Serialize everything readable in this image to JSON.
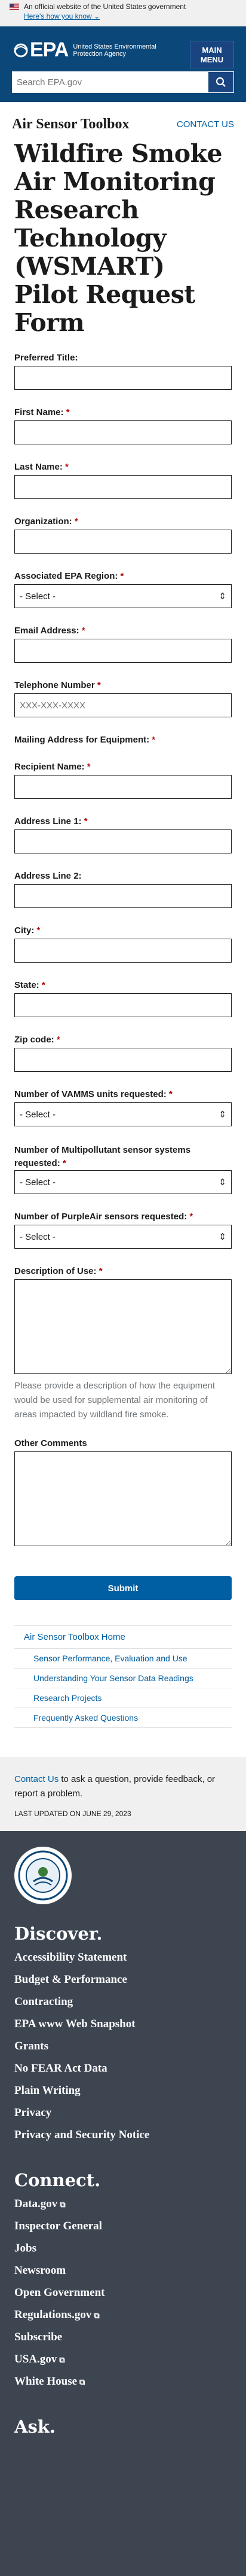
{
  "gov_banner": {
    "text": "An official website of the United States government",
    "link": "Here's how you know"
  },
  "header": {
    "logo_mark": "EPA",
    "logo_text": "United States Environmental Protection Agency",
    "menu_label_1": "MAIN",
    "menu_label_2": "MENU",
    "search_placeholder": "Search EPA.gov"
  },
  "breadcrumb": {
    "title": "Air Sensor Toolbox",
    "contact": "CONTACT US"
  },
  "page_title": "Wildfire Smoke Air Monitoring Research Technology (WSMART) Pilot Request Form",
  "form": {
    "preferred_title": "Preferred Title:",
    "first_name": "First Name:",
    "last_name": "Last Name:",
    "organization": "Organization:",
    "region": "Associated EPA Region:",
    "select_default": "- Select -",
    "email": "Email Address:",
    "phone": "Telephone Number",
    "phone_placeholder": "XXX-XXX-XXXX",
    "mailing": "Mailing Address for Equipment:",
    "recipient": "Recipient Name:",
    "address1": "Address Line 1:",
    "address2": "Address Line 2:",
    "city": "City:",
    "state": "State:",
    "zip": "Zip code:",
    "vamms": "Number of VAMMS units requested:",
    "multipollutant": "Number of Multipollutant sensor systems requested:",
    "purpleair": "Number of PurpleAir sensors requested:",
    "description": "Description of Use:",
    "description_help": "Please provide a description of how the equipment would be used for supplemental air monitoring of areas impacted by wildland fire smoke.",
    "comments": "Other Comments",
    "submit": "Submit",
    "required_mark": "*"
  },
  "sidenav": {
    "top": "Air Sensor Toolbox Home",
    "items": [
      "Sensor Performance, Evaluation and Use",
      "Understanding Your Sensor Data Readings",
      "Research Projects",
      "Frequently Asked Questions"
    ]
  },
  "contact_box": {
    "link": "Contact Us",
    "text": " to ask a question, provide feedback, or report a problem.",
    "updated": "LAST UPDATED ON JUNE 29, 2023"
  },
  "footer": {
    "discover": "Discover.",
    "discover_links": [
      "Accessibility Statement",
      "Budget & Performance",
      "Contracting",
      "EPA www Web Snapshot",
      "Grants",
      "No FEAR Act Data",
      "Plain Writing",
      "Privacy",
      "Privacy and Security Notice"
    ],
    "connect": "Connect.",
    "connect_links": [
      "Data.gov",
      "Inspector General",
      "Jobs",
      "Newsroom",
      "Open Government",
      "Regulations.gov",
      "Subscribe",
      "USA.gov",
      "White House"
    ],
    "ask": "Ask."
  },
  "colors": {
    "header_bg": "#0b4778",
    "link": "#005ea2",
    "required": "#b50909",
    "footer_bg": "#3d4551"
  }
}
